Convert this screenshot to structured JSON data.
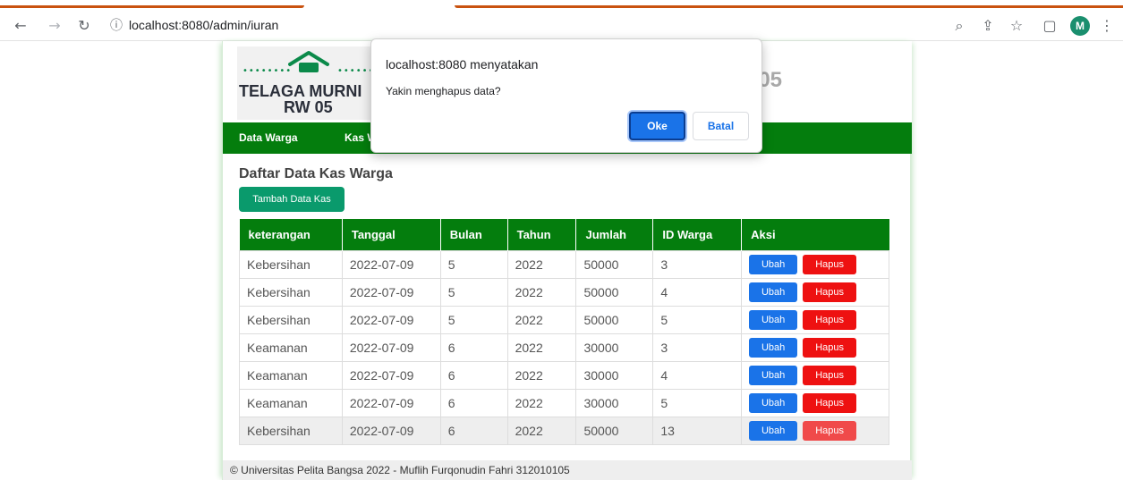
{
  "browser": {
    "url": "localhost:8080/admin/iuran",
    "profile_initial": "M",
    "icons": [
      "back-arrow-icon",
      "forward-arrow-icon",
      "reload-icon",
      "info-icon",
      "zoom-icon",
      "share-icon",
      "star-icon",
      "sidepanel-icon",
      "menu-icon"
    ]
  },
  "header": {
    "logo_line1": "TELAGA MURNI",
    "logo_line2": "RW 05",
    "title_partial": "/ 05"
  },
  "nav": {
    "items": [
      "Data Warga",
      "Kas W"
    ]
  },
  "content": {
    "title": "Daftar Data Kas Warga",
    "add_button": "Tambah Data Kas"
  },
  "table": {
    "columns": [
      "keterangan",
      "Tanggal",
      "Bulan",
      "Tahun",
      "Jumlah",
      "ID Warga",
      "Aksi"
    ],
    "rows": [
      [
        "Kebersihan",
        "2022-07-09",
        "5",
        "2022",
        "50000",
        "3"
      ],
      [
        "Kebersihan",
        "2022-07-09",
        "5",
        "2022",
        "50000",
        "4"
      ],
      [
        "Kebersihan",
        "2022-07-09",
        "5",
        "2022",
        "50000",
        "5"
      ],
      [
        "Keamanan",
        "2022-07-09",
        "6",
        "2022",
        "30000",
        "3"
      ],
      [
        "Keamanan",
        "2022-07-09",
        "6",
        "2022",
        "30000",
        "4"
      ],
      [
        "Keamanan",
        "2022-07-09",
        "6",
        "2022",
        "30000",
        "5"
      ],
      [
        "Kebersihan",
        "2022-07-09",
        "6",
        "2022",
        "50000",
        "13"
      ]
    ],
    "edit_label": "Ubah",
    "delete_label": "Hapus"
  },
  "footer": {
    "text": "© Universitas Pelita Bangsa 2022 - Muflih Furqonudin Fahri 312010105"
  },
  "dialog": {
    "title": "localhost:8080 menyatakan",
    "message": "Yakin menghapus data?",
    "ok_label": "Oke",
    "cancel_label": "Batal"
  },
  "colors": {
    "nav_green": "#047d0d",
    "add_button": "#0a9a6c",
    "edit_button": "#1a73e8",
    "delete_button": "#ee1111"
  }
}
